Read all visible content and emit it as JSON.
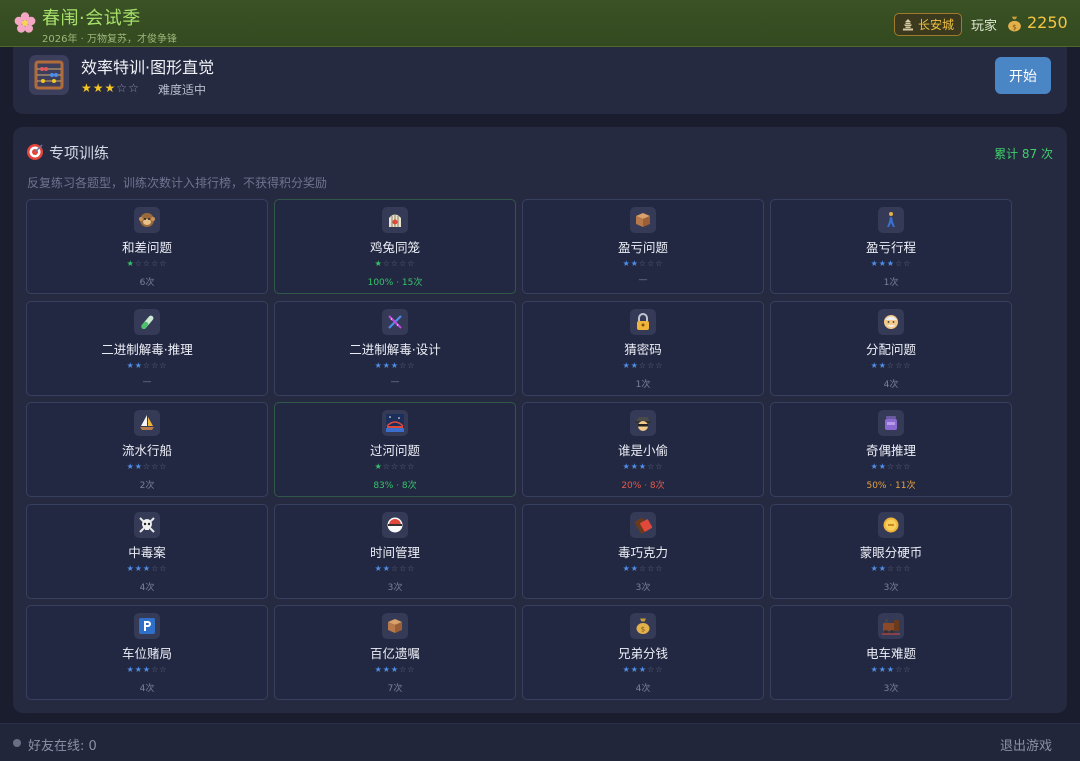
{
  "header": {
    "title": "春闱·会试季",
    "subtitle": "2026年 · 万物复苏，才俊争锋",
    "city": "长安城",
    "player": "玩家",
    "coins": "2250"
  },
  "featured": {
    "title": "效率特训·图形直觉",
    "stars": 3,
    "difficulty": "难度适中",
    "start_label": "开始"
  },
  "training": {
    "title": "专项训练",
    "total": "累计 87 次",
    "description": "反复练习各题型，训练次数计入排行榜，不获得积分奖励",
    "items": [
      {
        "name": "和差问题",
        "icon": "monkey-icon",
        "stars": 1,
        "star_color": "#35c46a",
        "stat": "6次",
        "stat_class": "",
        "border": "blue"
      },
      {
        "name": "鸡兔同笼",
        "icon": "cage-icon",
        "stars": 1,
        "star_color": "#35c46a",
        "stat": "100% · 15次",
        "stat_class": "stat-green",
        "border": "green"
      },
      {
        "name": "盈亏问题",
        "icon": "box-icon",
        "stars": 2,
        "star_color": "#4f8ee8",
        "stat": "—",
        "stat_class": "",
        "border": "blue"
      },
      {
        "name": "盈亏行程",
        "icon": "walker-icon",
        "stars": 3,
        "star_color": "#4f8ee8",
        "stat": "1次",
        "stat_class": "",
        "border": "blue"
      },
      {
        "name": "二进制解毒·推理",
        "icon": "test-tube-icon",
        "stars": 2,
        "star_color": "#4f8ee8",
        "stat": "—",
        "stat_class": "",
        "border": "blue"
      },
      {
        "name": "二进制解毒·设计",
        "icon": "dna-icon",
        "stars": 3,
        "star_color": "#4f8ee8",
        "stat": "—",
        "stat_class": "",
        "border": "blue"
      },
      {
        "name": "猜密码",
        "icon": "lock-icon",
        "stars": 2,
        "star_color": "#4f8ee8",
        "stat": "1次",
        "stat_class": "",
        "border": "blue"
      },
      {
        "name": "分配问题",
        "icon": "elder-icon",
        "stars": 2,
        "star_color": "#4f8ee8",
        "stat": "4次",
        "stat_class": "",
        "border": "blue"
      },
      {
        "name": "流水行船",
        "icon": "sailboat-icon",
        "stars": 2,
        "star_color": "#4f8ee8",
        "stat": "2次",
        "stat_class": "",
        "border": "blue"
      },
      {
        "name": "过河问题",
        "icon": "bridge-icon",
        "stars": 1,
        "star_color": "#35c46a",
        "stat": "83% · 8次",
        "stat_class": "stat-green",
        "border": "green"
      },
      {
        "name": "谁是小偷",
        "icon": "detective-icon",
        "stars": 3,
        "star_color": "#4f8ee8",
        "stat": "20% · 8次",
        "stat_class": "stat-red",
        "border": "blue"
      },
      {
        "name": "奇偶推理",
        "icon": "jar-icon",
        "stars": 2,
        "star_color": "#4f8ee8",
        "stat": "50% · 11次",
        "stat_class": "stat-orange",
        "border": "blue"
      },
      {
        "name": "中毒案",
        "icon": "skull-icon",
        "stars": 3,
        "star_color": "#4f8ee8",
        "stat": "4次",
        "stat_class": "",
        "border": "blue"
      },
      {
        "name": "时间管理",
        "icon": "bowl-icon",
        "stars": 2,
        "star_color": "#4f8ee8",
        "stat": "3次",
        "stat_class": "",
        "border": "blue"
      },
      {
        "name": "毒巧克力",
        "icon": "chocolate-icon",
        "stars": 2,
        "star_color": "#4f8ee8",
        "stat": "3次",
        "stat_class": "",
        "border": "blue"
      },
      {
        "name": "蒙眼分硬币",
        "icon": "coin-icon",
        "stars": 2,
        "star_color": "#4f8ee8",
        "stat": "3次",
        "stat_class": "",
        "border": "blue"
      },
      {
        "name": "车位赌局",
        "icon": "parking-icon",
        "stars": 3,
        "star_color": "#4f8ee8",
        "stat": "4次",
        "stat_class": "",
        "border": "blue"
      },
      {
        "name": "百亿遗嘱",
        "icon": "box-icon",
        "stars": 3,
        "star_color": "#4f8ee8",
        "stat": "7次",
        "stat_class": "",
        "border": "blue"
      },
      {
        "name": "兄弟分钱",
        "icon": "money-bag-icon",
        "stars": 3,
        "star_color": "#4f8ee8",
        "stat": "4次",
        "stat_class": "",
        "border": "blue"
      },
      {
        "name": "电车难题",
        "icon": "train-icon",
        "stars": 3,
        "star_color": "#4f8ee8",
        "stat": "3次",
        "stat_class": "",
        "border": "blue"
      }
    ]
  },
  "footer": {
    "online": "好友在线: 0",
    "exit": "退出游戏"
  },
  "colors": {
    "accent_green": "#3fcf6a",
    "accent_blue": "#4a86c5",
    "gold": "#f5c542"
  }
}
